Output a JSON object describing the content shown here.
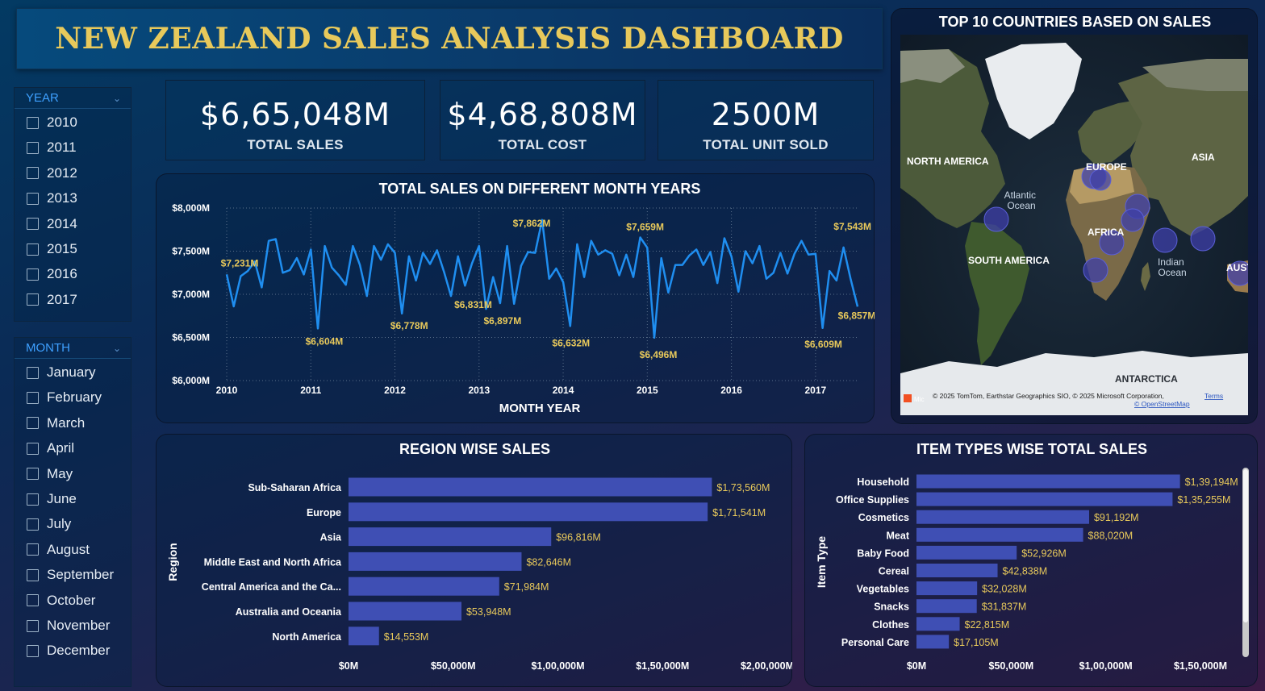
{
  "title": "NEW ZEALAND SALES ANALYSIS DASHBOARD",
  "year_slicer": {
    "header": "YEAR",
    "items": [
      "2010",
      "2011",
      "2012",
      "2013",
      "2014",
      "2015",
      "2016",
      "2017"
    ]
  },
  "month_slicer": {
    "header": "MONTH",
    "items": [
      "January",
      "February",
      "March",
      "April",
      "May",
      "June",
      "July",
      "August",
      "September",
      "October",
      "November",
      "December"
    ]
  },
  "kpis": [
    {
      "value": "$6,65,048M",
      "label": "TOTAL SALES"
    },
    {
      "value": "$4,68,808M",
      "label": "TOTAL COST"
    },
    {
      "value": "2500M",
      "label": "TOTAL UNIT SOLD"
    }
  ],
  "map": {
    "title": "TOP 10 COUNTRIES BASED ON SALES",
    "labels": [
      "NORTH AMERICA",
      "EUROPE",
      "ASIA",
      "Atlantic Ocean",
      "AFRICA",
      "SOUTH AMERICA",
      "Indian Ocean",
      "AUST",
      "ANTARCTICA"
    ],
    "attribution": "© 2025 TomTom, Earthstar Geographics SIO, © 2025 Microsoft Corporation,",
    "terms": "Terms",
    "osm": "© OpenStreetMap",
    "ms_logo_text": "Mic"
  },
  "colors": {
    "line": "#1f8ef0",
    "bar": "#3f4fb4",
    "data_label": "#e8c95b",
    "title_gold": "#e8c95b"
  },
  "chart_data": [
    {
      "type": "line",
      "title": "TOTAL SALES ON DIFFERENT MONTH YEARS",
      "xlabel": "MONTH YEAR",
      "ylabel": "",
      "ylim": [
        6000,
        8000
      ],
      "y_ticks": [
        "$6,000M",
        "$6,500M",
        "$7,000M",
        "$7,500M",
        "$8,000M"
      ],
      "x_ticks": [
        "2010",
        "2011",
        "2012",
        "2013",
        "2014",
        "2015",
        "2016",
        "2017"
      ],
      "grid": true,
      "series": [
        {
          "values": [
            7231,
            6860,
            7210,
            7270,
            7380,
            7080,
            7620,
            7640,
            7250,
            7280,
            7420,
            7230,
            7520,
            6604,
            7560,
            7310,
            7220,
            7110,
            7560,
            7340,
            6980,
            7560,
            7400,
            7580,
            7480,
            6778,
            7440,
            7160,
            7480,
            7350,
            7510,
            7260,
            6980,
            7440,
            7100,
            7360,
            7560,
            6831,
            7200,
            6897,
            7560,
            6890,
            7330,
            7490,
            7480,
            7862,
            7180,
            7300,
            7140,
            6632,
            7580,
            7200,
            7620,
            7460,
            7510,
            7470,
            7220,
            7460,
            7200,
            7659,
            7540,
            6496,
            7420,
            7020,
            7340,
            7340,
            7450,
            7520,
            7340,
            7490,
            7130,
            7650,
            7440,
            7030,
            7500,
            7360,
            7560,
            7180,
            7250,
            7480,
            7240,
            7470,
            7620,
            7460,
            7470,
            6609,
            7270,
            7160,
            7543,
            7180,
            6857
          ]
        }
      ],
      "annotations": [
        "$7,231M",
        "$6,604M",
        "$6,778M",
        "$6,831M",
        "$6,897M",
        "$7,862M",
        "$6,632M",
        "$7,659M",
        "$6,496M",
        "$6,609M",
        "$7,543M",
        "$6,857M"
      ]
    },
    {
      "type": "bar",
      "orientation": "horizontal",
      "title": "REGION WISE SALES",
      "ylabel": "Region",
      "xlim": [
        0,
        200000
      ],
      "x_ticks": [
        "$0M",
        "$50,000M",
        "$1,00,000M",
        "$1,50,000M",
        "$2,00,000M"
      ],
      "categories": [
        "Sub-Saharan Africa",
        "Europe",
        "Asia",
        "Middle East and North Africa",
        "Central America and the Ca...",
        "Australia and Oceania",
        "North America"
      ],
      "values": [
        173560,
        171541,
        96816,
        82646,
        71984,
        53948,
        14553
      ],
      "data_labels": [
        "$1,73,560M",
        "$1,71,541M",
        "$96,816M",
        "$82,646M",
        "$71,984M",
        "$53,948M",
        "$14,553M"
      ]
    },
    {
      "type": "bar",
      "orientation": "horizontal",
      "title": "ITEM TYPES WISE TOTAL SALES",
      "ylabel": "Item Type",
      "xlim": [
        0,
        150000
      ],
      "x_ticks": [
        "$0M",
        "$50,000M",
        "$1,00,000M",
        "$1,50,000M"
      ],
      "categories": [
        "Household",
        "Office Supplies",
        "Cosmetics",
        "Meat",
        "Baby Food",
        "Cereal",
        "Vegetables",
        "Snacks",
        "Clothes",
        "Personal Care"
      ],
      "values": [
        139194,
        135255,
        91192,
        88020,
        52926,
        42838,
        32028,
        31837,
        22815,
        17105
      ],
      "data_labels": [
        "$1,39,194M",
        "$1,35,255M",
        "$91,192M",
        "$88,020M",
        "$52,926M",
        "$42,838M",
        "$32,028M",
        "$31,837M",
        "$22,815M",
        "$17,105M"
      ]
    }
  ]
}
